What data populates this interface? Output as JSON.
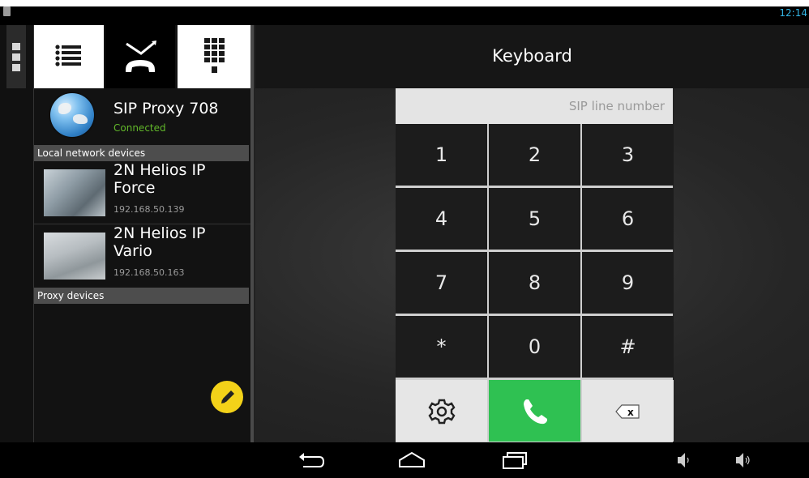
{
  "status_bar": {
    "time": "12:14"
  },
  "tabs": [
    {
      "name": "contacts",
      "icon": "list-icon"
    },
    {
      "name": "calls",
      "icon": "missed-call-icon"
    },
    {
      "name": "keyboard",
      "icon": "dialpad-icon"
    }
  ],
  "header": {
    "title": "Keyboard"
  },
  "proxy": {
    "name": "SIP Proxy 708",
    "status": "Connected",
    "status_color": "#62b82a"
  },
  "sections": {
    "local": "Local network devices",
    "proxy": "Proxy devices"
  },
  "devices": [
    {
      "name": "2N Helios IP Force",
      "ip": "192.168.50.139"
    },
    {
      "name": "2N Helios IP Vario",
      "ip": "192.168.50.163"
    }
  ],
  "dialer": {
    "placeholder": "SIP line number",
    "keys": [
      "1",
      "2",
      "3",
      "4",
      "5",
      "6",
      "7",
      "8",
      "9",
      "*",
      "0",
      "#"
    ],
    "call_color": "#2fc152"
  },
  "fab": {
    "icon": "edit-pencil-icon",
    "color": "#f3d219"
  },
  "navigation": [
    "back-icon",
    "home-icon",
    "recent-apps-icon",
    "volume-down-icon",
    "volume-up-icon"
  ]
}
